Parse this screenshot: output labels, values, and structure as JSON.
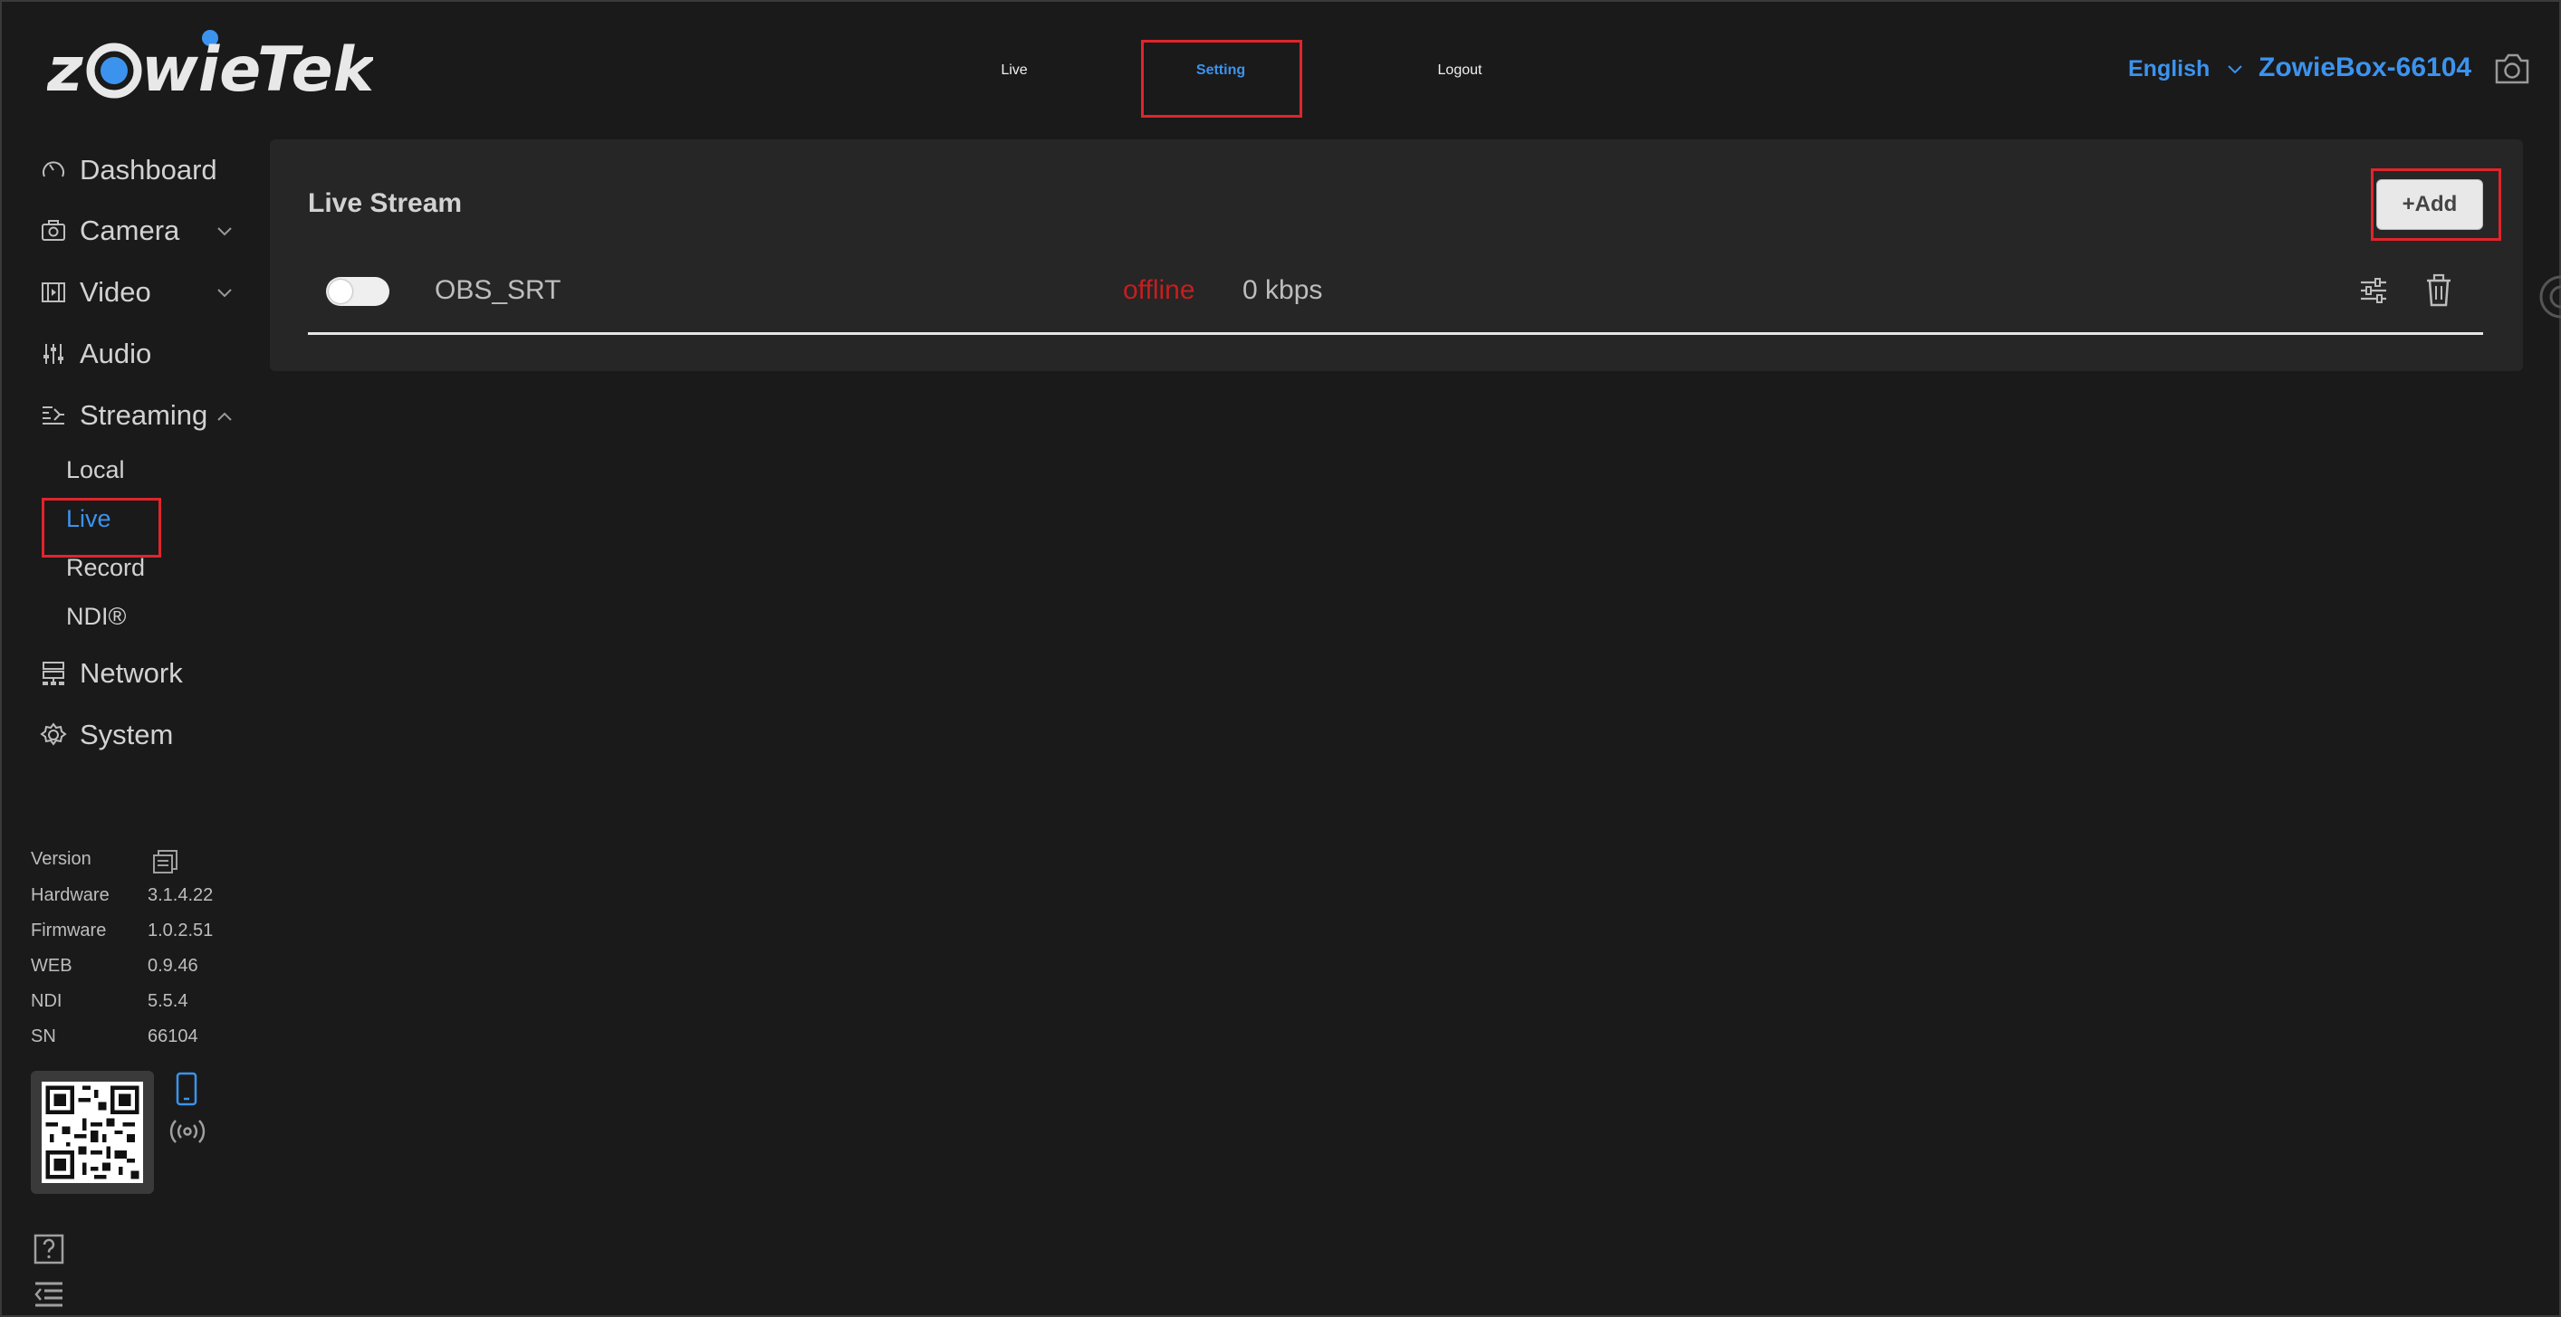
{
  "header": {
    "logo_text": "zowieTek",
    "nav": [
      {
        "label": "Live"
      },
      {
        "label": "Setting"
      },
      {
        "label": "Logout"
      }
    ],
    "language": "English",
    "device_name": "ZowieBox-66104"
  },
  "sidebar": {
    "items": [
      {
        "label": "Dashboard"
      },
      {
        "label": "Camera"
      },
      {
        "label": "Video"
      },
      {
        "label": "Audio"
      },
      {
        "label": "Streaming"
      },
      {
        "label": "Network"
      },
      {
        "label": "System"
      }
    ],
    "streaming_sub": [
      {
        "label": "Local"
      },
      {
        "label": "Live"
      },
      {
        "label": "Record"
      },
      {
        "label": "NDI®"
      }
    ],
    "version": {
      "title": "Version",
      "rows": [
        {
          "label": "Hardware",
          "value": "3.1.4.22"
        },
        {
          "label": "Firmware",
          "value": "1.0.2.51"
        },
        {
          "label": "WEB",
          "value": "0.9.46"
        },
        {
          "label": "NDI",
          "value": "5.5.4"
        },
        {
          "label": "SN",
          "value": "66104"
        }
      ]
    }
  },
  "panel": {
    "title": "Live Stream",
    "add_label": "+Add",
    "streams": [
      {
        "name": "OBS_SRT",
        "status": "offline",
        "rate": "0 kbps",
        "enabled": false
      }
    ]
  },
  "colors": {
    "accent": "#3c93ee",
    "offline": "#c61e1e",
    "highlight": "#e0252b",
    "background": "#1a1a1a",
    "panel": "#262626"
  }
}
